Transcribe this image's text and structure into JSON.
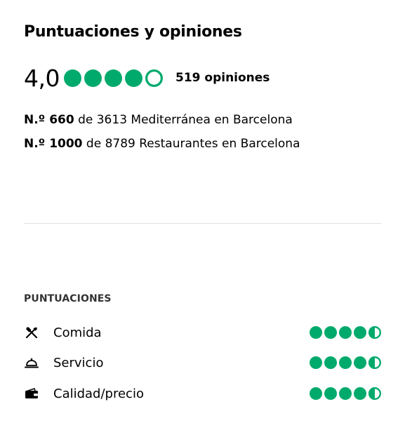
{
  "header": {
    "title": "Puntuaciones y opiniones"
  },
  "overall": {
    "score": "4,0",
    "rating": 4.0,
    "max_rating": 5,
    "review_count": "519 opiniones"
  },
  "rankings": [
    {
      "position": "N.º 660",
      "rest": " de 3613 Mediterránea en Barcelona"
    },
    {
      "position": "N.º 1000",
      "rest": " de 8789 Restaurantes en Barcelona"
    }
  ],
  "ratings_section": {
    "heading": "PUNTUACIONES",
    "items": [
      {
        "label": "Comida",
        "icon": "fork-knife-icon",
        "rating": 4.5
      },
      {
        "label": "Servicio",
        "icon": "service-bell-icon",
        "rating": 4.5
      },
      {
        "label": "Calidad/precio",
        "icon": "wallet-icon",
        "rating": 4.5
      }
    ]
  },
  "colors": {
    "bubble": "#00aa6c",
    "text": "#000000",
    "divider": "#e0e0e0"
  }
}
